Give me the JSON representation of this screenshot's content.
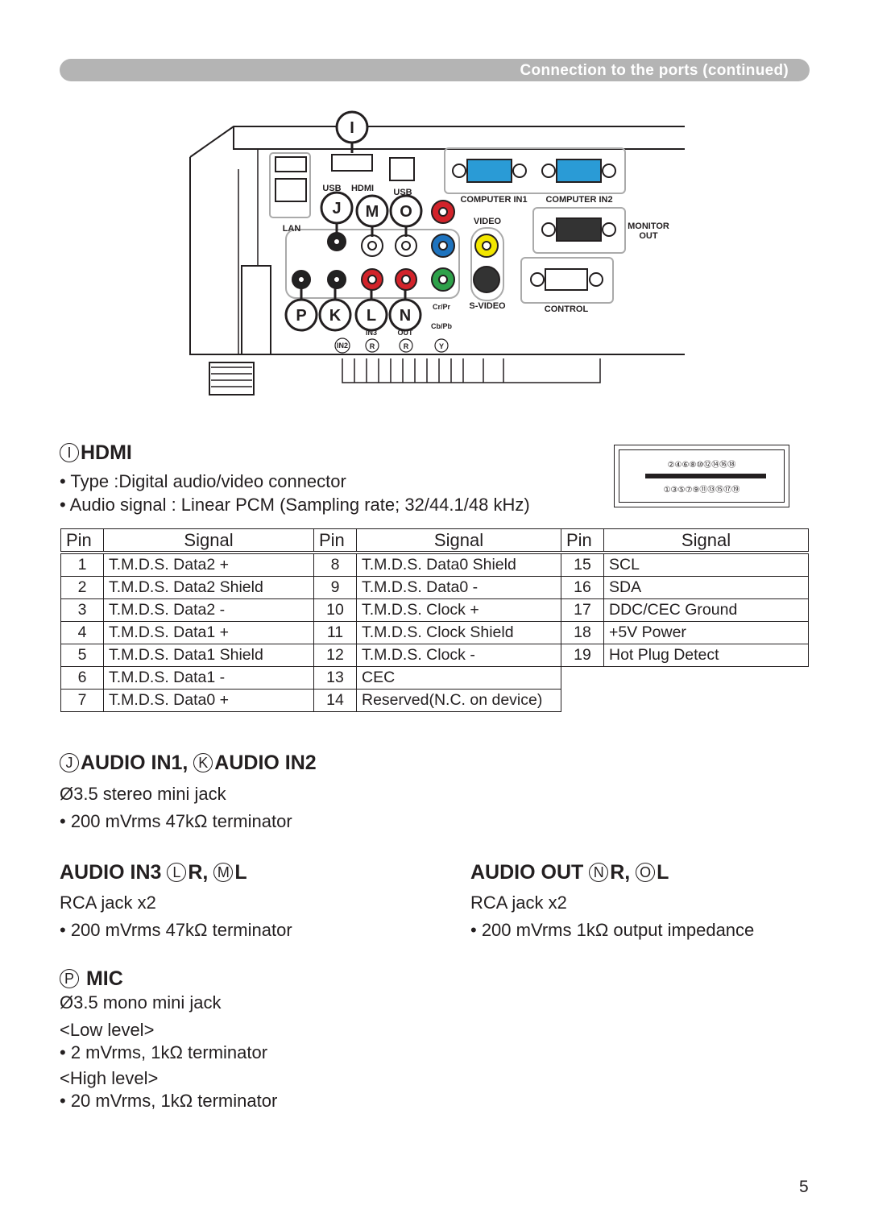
{
  "header": {
    "title": "Connection to the ports (continued)"
  },
  "diagram": {
    "callouts": [
      "I",
      "J",
      "M",
      "O",
      "P",
      "K",
      "L",
      "N"
    ],
    "labels": {
      "usb1": "USB",
      "hdmi": "HDMI",
      "usb2": "USB",
      "lan": "LAN",
      "computer_in1": "COMPUTER IN1",
      "computer_in2": "COMPUTER IN2",
      "video": "VIDEO",
      "monitor": "MONITOR",
      "out": "OUT",
      "svideo": "S-VIDEO",
      "control": "CONTROL",
      "crpr": "Cr/Pr",
      "cbpb": "Cb/Pb",
      "in3": "IN3",
      "audio_out": "OUT",
      "in2": "IN2",
      "r1": "R",
      "r2": "R",
      "y": "Y"
    },
    "jack_colors": {
      "red": "#d2232a",
      "blue": "#1e73be",
      "green": "#2ea14a",
      "yellow": "#f2e600",
      "vga": "#2a9bd6"
    }
  },
  "hdmi": {
    "letter": "I",
    "title": "HDMI",
    "bullets": [
      "• Type :Digital audio/video connector",
      "• Audio signal : Linear PCM (Sampling rate; 32/44.1/48 kHz)"
    ],
    "connector_top_pins": "②④⑥⑧⑩⑫⑭⑯⑱",
    "connector_bottom_pins": "①③⑤⑦⑨⑪⑬⑮⑰⑲",
    "table": {
      "headers": [
        "Pin",
        "Signal",
        "Pin",
        "Signal",
        "Pin",
        "Signal"
      ],
      "rows": [
        [
          "1",
          "T.M.D.S. Data2 +",
          "8",
          "T.M.D.S. Data0 Shield",
          "15",
          "SCL"
        ],
        [
          "2",
          "T.M.D.S. Data2 Shield",
          "9",
          "T.M.D.S. Data0 -",
          "16",
          "SDA"
        ],
        [
          "3",
          "T.M.D.S. Data2 -",
          "10",
          "T.M.D.S. Clock +",
          "17",
          "DDC/CEC Ground"
        ],
        [
          "4",
          "T.M.D.S. Data1 +",
          "11",
          "T.M.D.S. Clock Shield",
          "18",
          "+5V Power"
        ],
        [
          "5",
          "T.M.D.S. Data1 Shield",
          "12",
          "T.M.D.S. Clock -",
          "19",
          "Hot Plug Detect"
        ],
        [
          "6",
          "T.M.D.S. Data1 -",
          "13",
          "CEC",
          "",
          ""
        ],
        [
          "7",
          "T.M.D.S. Data0 +",
          "14",
          "Reserved(N.C. on device)",
          "",
          ""
        ]
      ]
    }
  },
  "audio_in12": {
    "letter1": "J",
    "title1": "AUDIO IN1, ",
    "letter2": "K",
    "title2": "AUDIO IN2",
    "lines": [
      "Ø3.5 stereo mini jack",
      "• 200 mVrms 47kΩ terminator"
    ]
  },
  "audio_in3": {
    "title": "AUDIO IN3 ",
    "letter1": "L",
    "sep": "R, ",
    "letter2": "M",
    "end": "L",
    "lines": [
      "RCA jack x2",
      "• 200 mVrms 47kΩ terminator"
    ]
  },
  "audio_out": {
    "title": "AUDIO OUT ",
    "letter1": "N",
    "sep": "R, ",
    "letter2": "O",
    "end": "L",
    "lines": [
      "RCA jack x2",
      "• 200 mVrms 1kΩ output impedance"
    ]
  },
  "mic": {
    "letter": "P",
    "title": " MIC",
    "lines": [
      "Ø3.5 mono mini jack",
      "<Low level>",
      "• 2 mVrms, 1kΩ terminator",
      "<High level>",
      "• 20 mVrms, 1kΩ terminator"
    ]
  },
  "page_number": "5"
}
